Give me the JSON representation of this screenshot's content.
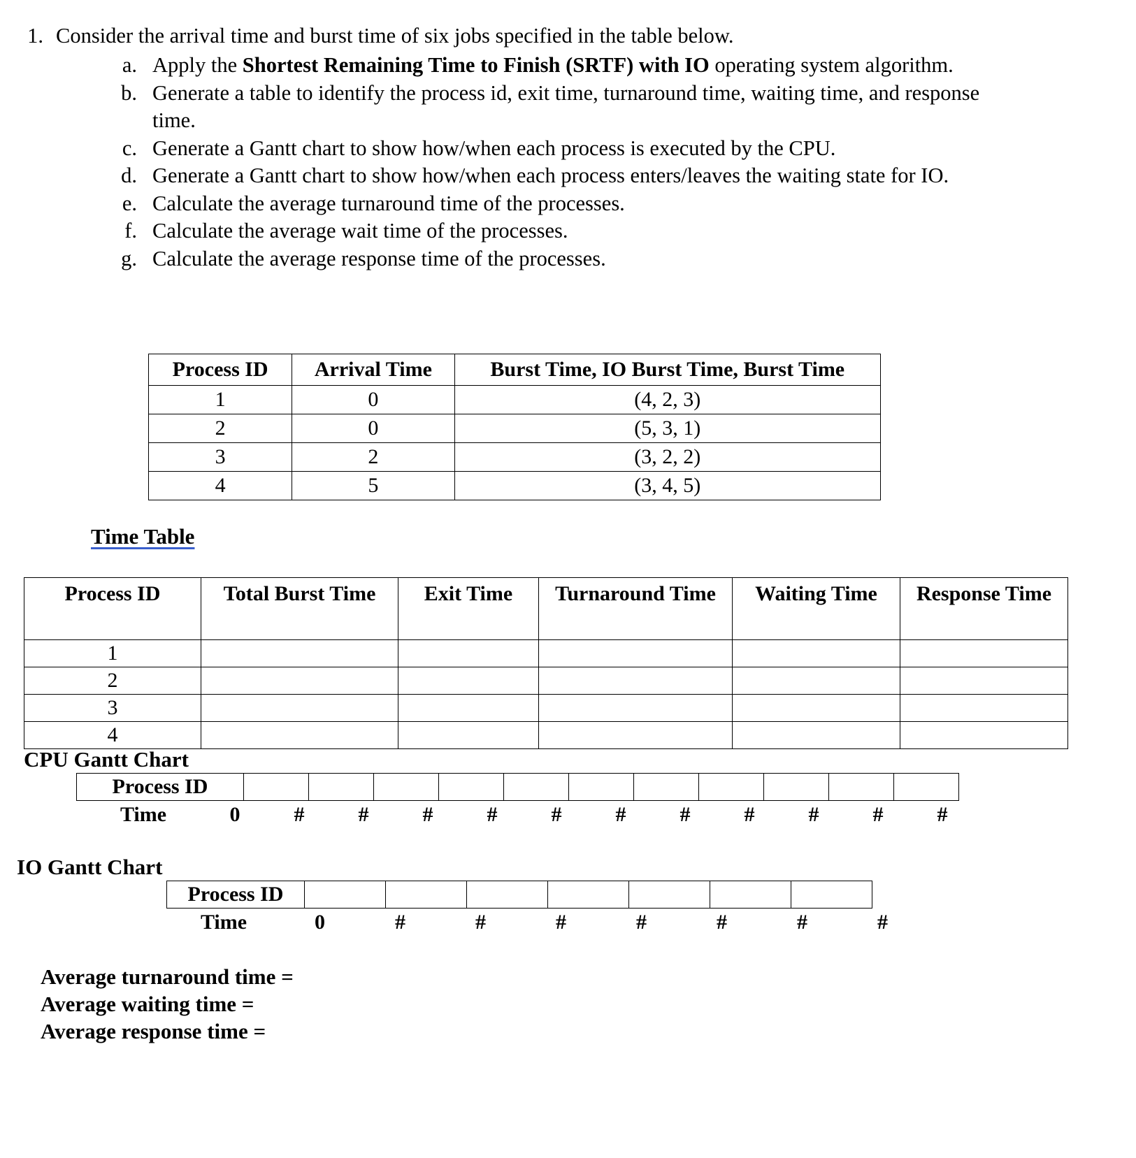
{
  "question": {
    "number": "1.",
    "prompt": "Consider the arrival time and burst time of six jobs specified in the table below.",
    "subitems": [
      {
        "letter": "a.",
        "text_before": "Apply the ",
        "text_bold": "Shortest Remaining Time to Finish (SRTF) with IO",
        "text_after": " operating system algorithm."
      },
      {
        "letter": "b.",
        "text_before": "Generate a table to identify the process id, exit time, turnaround time, waiting time, and response time.",
        "text_bold": "",
        "text_after": ""
      },
      {
        "letter": "c.",
        "text_before": "Generate a Gantt chart to show how/when each process is executed by the CPU.",
        "text_bold": "",
        "text_after": ""
      },
      {
        "letter": "d.",
        "text_before": "Generate a Gantt chart to show how/when each process enters/leaves the waiting state for IO.",
        "text_bold": "",
        "text_after": ""
      },
      {
        "letter": "e.",
        "text_before": "Calculate the average turnaround time of the processes.",
        "text_bold": "",
        "text_after": ""
      },
      {
        "letter": "f.",
        "text_before": "Calculate the average wait time of the processes.",
        "text_bold": "",
        "text_after": ""
      },
      {
        "letter": "g.",
        "text_before": "Calculate the average response time of the processes.",
        "text_bold": "",
        "text_after": ""
      }
    ]
  },
  "params_table": {
    "headers": [
      "Process ID",
      "Arrival Time",
      "Burst Time, IO Burst Time, Burst Time"
    ],
    "rows": [
      {
        "process_id": "1",
        "arrival_time": "0",
        "bursts": "(4, 2, 3)"
      },
      {
        "process_id": "2",
        "arrival_time": "0",
        "bursts": "(5, 3, 1)"
      },
      {
        "process_id": "3",
        "arrival_time": "2",
        "bursts": "(3, 2, 2)"
      },
      {
        "process_id": "4",
        "arrival_time": "5",
        "bursts": "(3, 4, 5)"
      }
    ]
  },
  "time_table": {
    "heading": "Time Table",
    "heading_underline_color": "#3A5FCD",
    "headers": [
      "Process ID",
      "Total Burst Time",
      "Exit Time",
      "Turnaround Time",
      "Waiting Time",
      "Response Time"
    ],
    "rows": [
      {
        "process_id": "1",
        "total_burst_time": "",
        "exit_time": "",
        "turnaround_time": "",
        "waiting_time": "",
        "response_time": ""
      },
      {
        "process_id": "2",
        "total_burst_time": "",
        "exit_time": "",
        "turnaround_time": "",
        "waiting_time": "",
        "response_time": ""
      },
      {
        "process_id": "3",
        "total_burst_time": "",
        "exit_time": "",
        "turnaround_time": "",
        "waiting_time": "",
        "response_time": ""
      },
      {
        "process_id": "4",
        "total_burst_time": "",
        "exit_time": "",
        "turnaround_time": "",
        "waiting_time": "",
        "response_time": ""
      }
    ]
  },
  "cpu_gantt": {
    "heading": "CPU Gantt Chart",
    "row_label": "Process ID",
    "cells": [
      "",
      "",
      "",
      "",
      "",
      "",
      "",
      "",
      "",
      "",
      ""
    ],
    "time_label": "Time",
    "time_ticks": [
      "0",
      "#",
      "#",
      "#",
      "#",
      "#",
      "#",
      "#",
      "#",
      "#",
      "#",
      "#"
    ]
  },
  "io_gantt": {
    "heading": "IO Gantt Chart",
    "row_label": "Process ID",
    "cells": [
      "",
      "",
      "",
      "",
      "",
      "",
      ""
    ],
    "time_label": "Time",
    "time_ticks": [
      "0",
      "#",
      "#",
      "#",
      "#",
      "#",
      "#",
      "#"
    ]
  },
  "averages": {
    "turnaround": "Average turnaround time =",
    "waiting": "Average waiting time =",
    "response": "Average response time ="
  },
  "chart_data": {
    "type": "table",
    "title": "SRTF with IO scheduling worksheet",
    "process_parameters": {
      "columns": [
        "Process ID",
        "Arrival Time",
        "Burst Time",
        "IO Burst Time",
        "Burst Time"
      ],
      "rows": [
        {
          "process_id": 1,
          "arrival_time": 0,
          "burst_1": 4,
          "io_burst": 2,
          "burst_2": 3
        },
        {
          "process_id": 2,
          "arrival_time": 0,
          "burst_1": 5,
          "io_burst": 3,
          "burst_2": 1
        },
        {
          "process_id": 3,
          "arrival_time": 2,
          "burst_1": 3,
          "io_burst": 2,
          "burst_2": 2
        },
        {
          "process_id": 4,
          "arrival_time": 5,
          "burst_1": 3,
          "io_burst": 4,
          "burst_2": 5
        }
      ]
    },
    "time_table_columns": [
      "Process ID",
      "Total Burst Time",
      "Exit Time",
      "Turnaround Time",
      "Waiting Time",
      "Response Time"
    ],
    "time_table_values": [
      [
        1,
        null,
        null,
        null,
        null,
        null
      ],
      [
        2,
        null,
        null,
        null,
        null,
        null
      ],
      [
        3,
        null,
        null,
        null,
        null,
        null
      ],
      [
        4,
        null,
        null,
        null,
        null,
        null
      ]
    ],
    "cpu_gantt_slots": 11,
    "io_gantt_slots": 7
  }
}
